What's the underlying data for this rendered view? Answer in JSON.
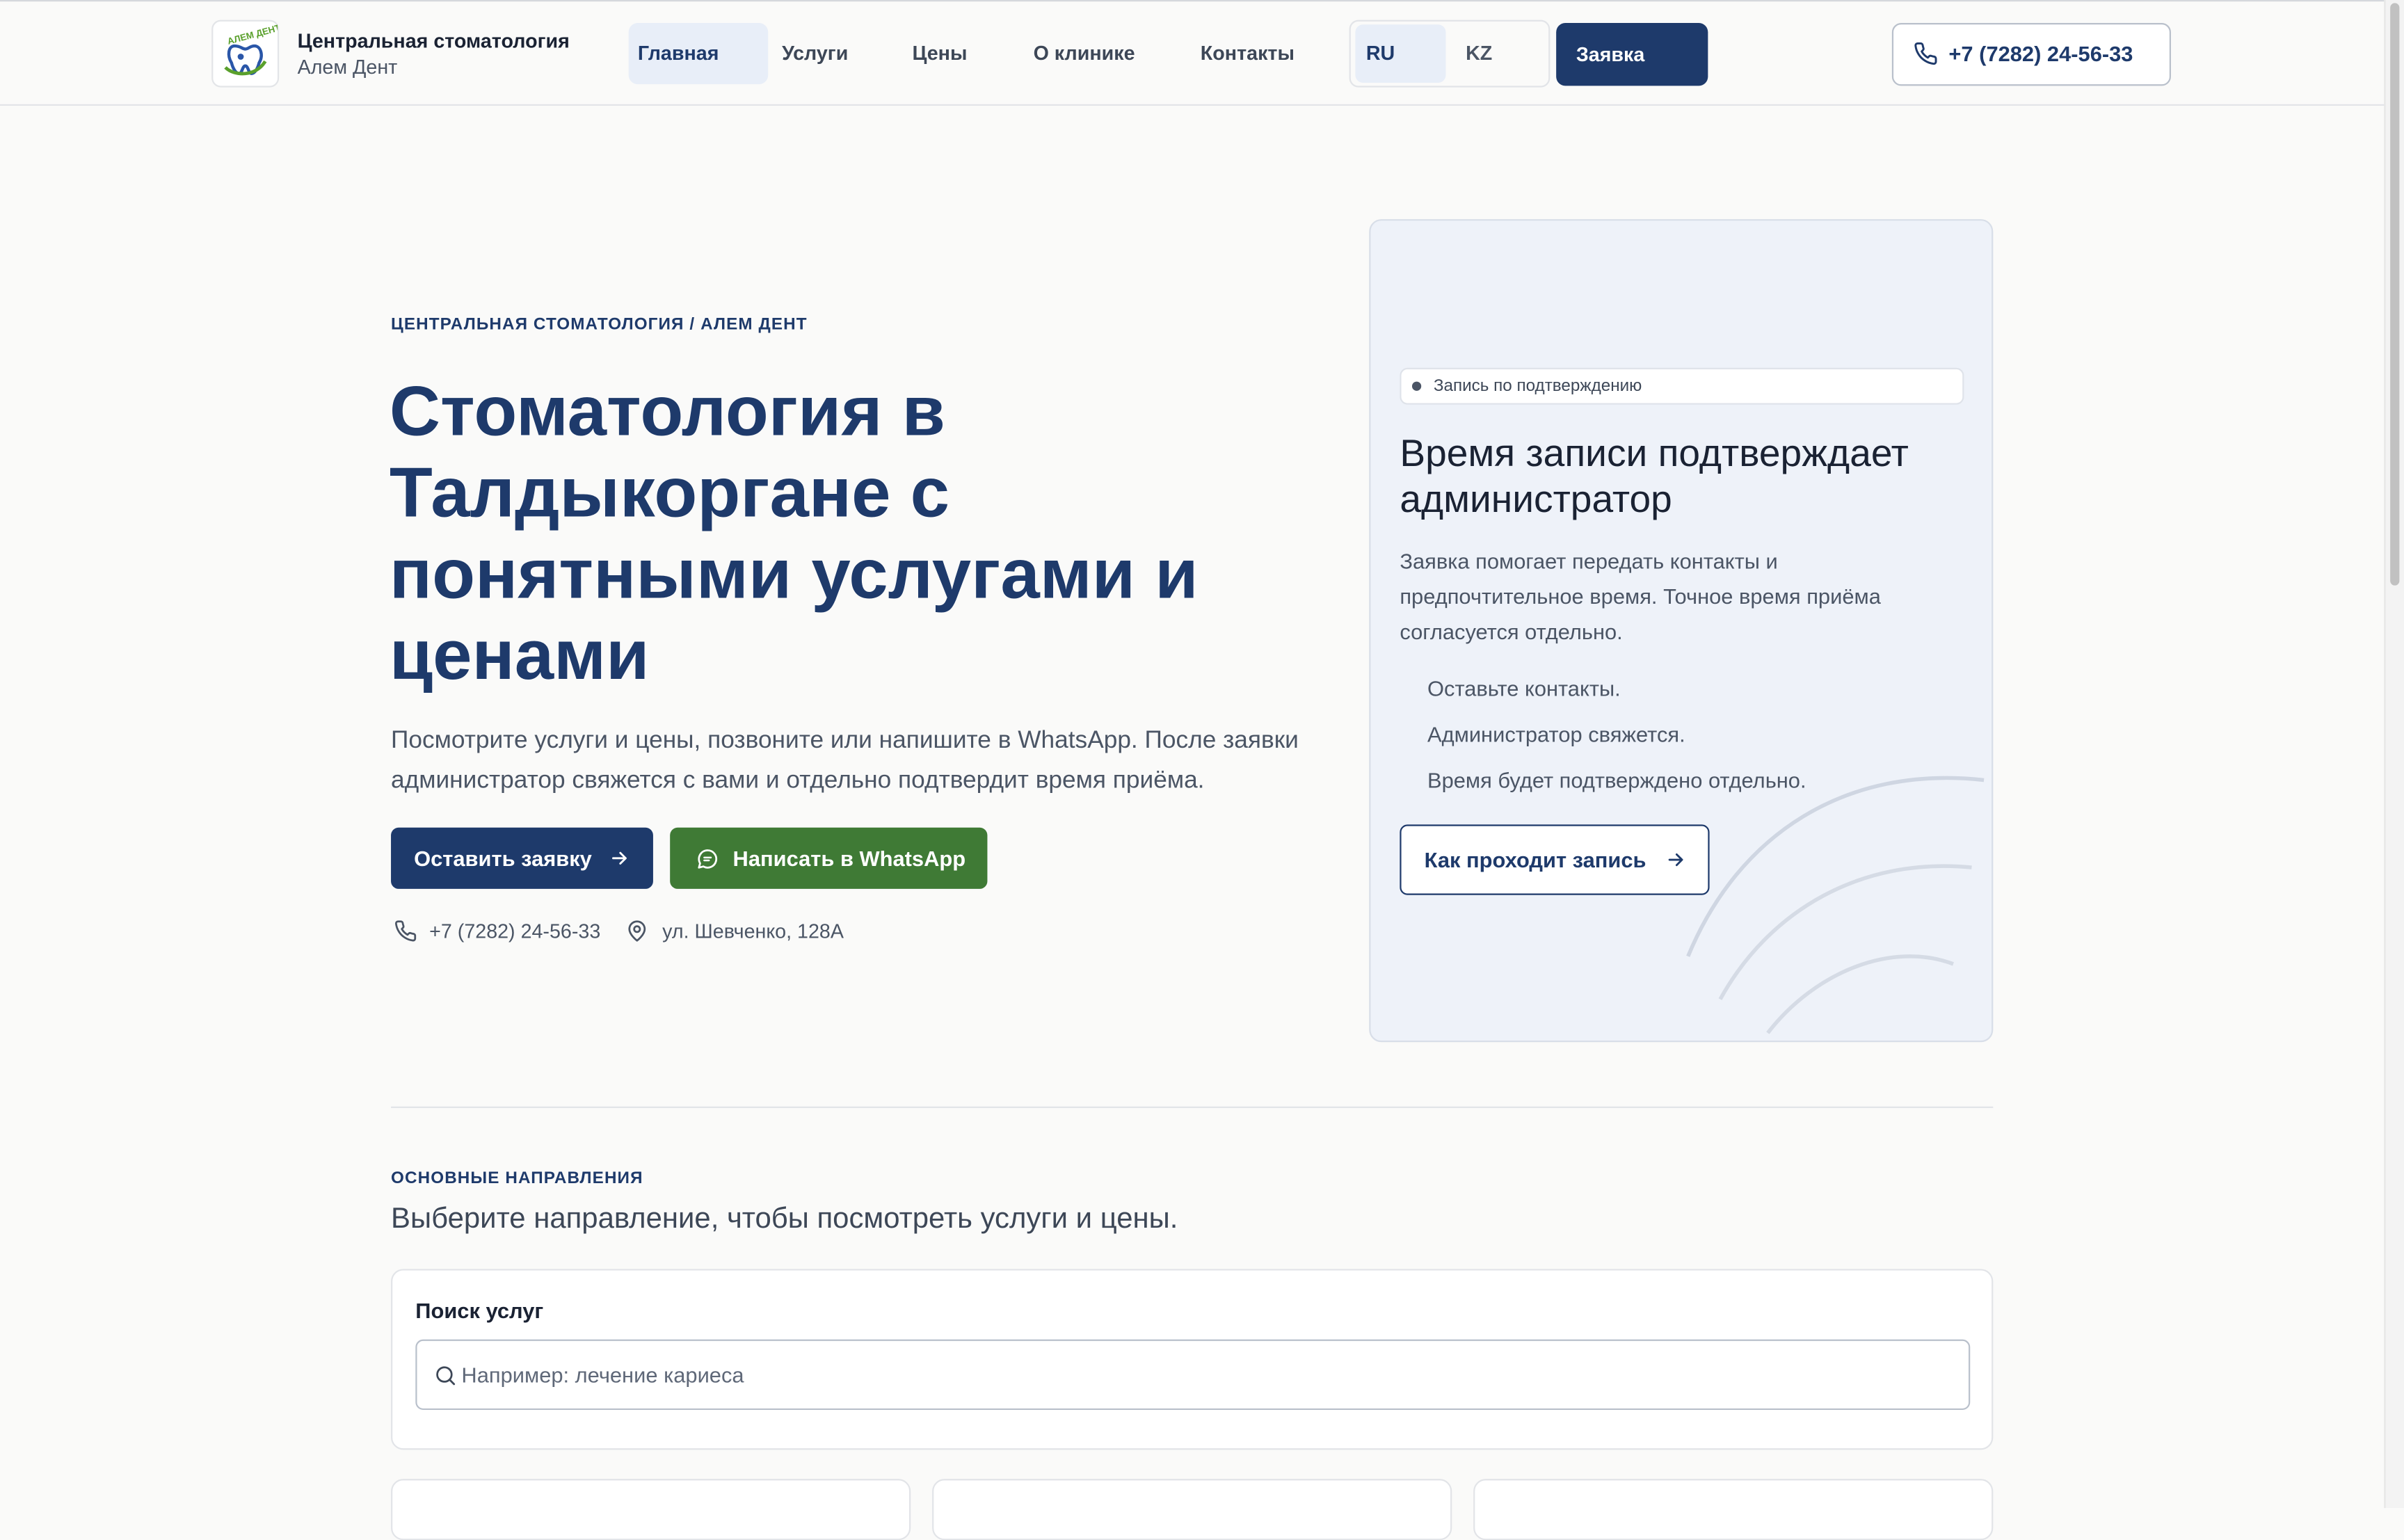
{
  "header": {
    "brand_title": "Центральная стоматология",
    "brand_subtitle": "Алем Дент",
    "logo_text": "АЛЕМ ДЕНТ",
    "nav": [
      {
        "label": "Главная",
        "active": true
      },
      {
        "label": "Услуги",
        "active": false
      },
      {
        "label": "Цены",
        "active": false
      },
      {
        "label": "О клинике",
        "active": false
      },
      {
        "label": "Контакты",
        "active": false
      }
    ],
    "languages": [
      {
        "label": "RU",
        "active": true
      },
      {
        "label": "KZ",
        "active": false
      }
    ],
    "request_button": "Заявка",
    "phone": "+7 (7282) 24-56-33"
  },
  "hero": {
    "eyebrow": "ЦЕНТРАЛЬНАЯ СТОМАТОЛОГИЯ / АЛЕМ ДЕНТ",
    "title": "Стоматология в Талдыкоргане с понятными услугами и ценами",
    "text": "Посмотрите услуги и цены, позвоните или напишите в WhatsApp. После заявки администратор свяжется с вами и отдельно подтвердит время приёма.",
    "primary_button": "Оставить заявку",
    "whatsapp_button": "Написать в WhatsApp",
    "phone": "+7 (7282) 24-56-33",
    "address": "ул. Шевченко, 128А"
  },
  "card": {
    "badge": "Запись по подтверждению",
    "title": "Время записи подтверждает администратор",
    "text": "Заявка помогает передать контакты и предпочтительное время. Точное время приёма согласуется отдельно.",
    "steps": [
      "Оставьте контакты.",
      "Администратор свяжется.",
      "Время будет подтверждено отдельно."
    ],
    "button": "Как проходит запись"
  },
  "directions": {
    "eyebrow": "ОСНОВНЫЕ НАПРАВЛЕНИЯ",
    "title": "Выберите направление, чтобы посмотреть услуги и цены.",
    "search_label": "Поиск услуг",
    "search_placeholder": "Например: лечение кариеса",
    "search_value": ""
  },
  "colors": {
    "primary": "#1e3a6b",
    "whatsapp": "#3f7a35",
    "background": "#fafaf9",
    "card_bg": "#eef2f9"
  },
  "icons": {
    "phone": "phone-icon",
    "location": "map-pin-icon",
    "arrow": "arrow-right-icon",
    "whatsapp": "chat-icon",
    "search": "search-icon"
  }
}
